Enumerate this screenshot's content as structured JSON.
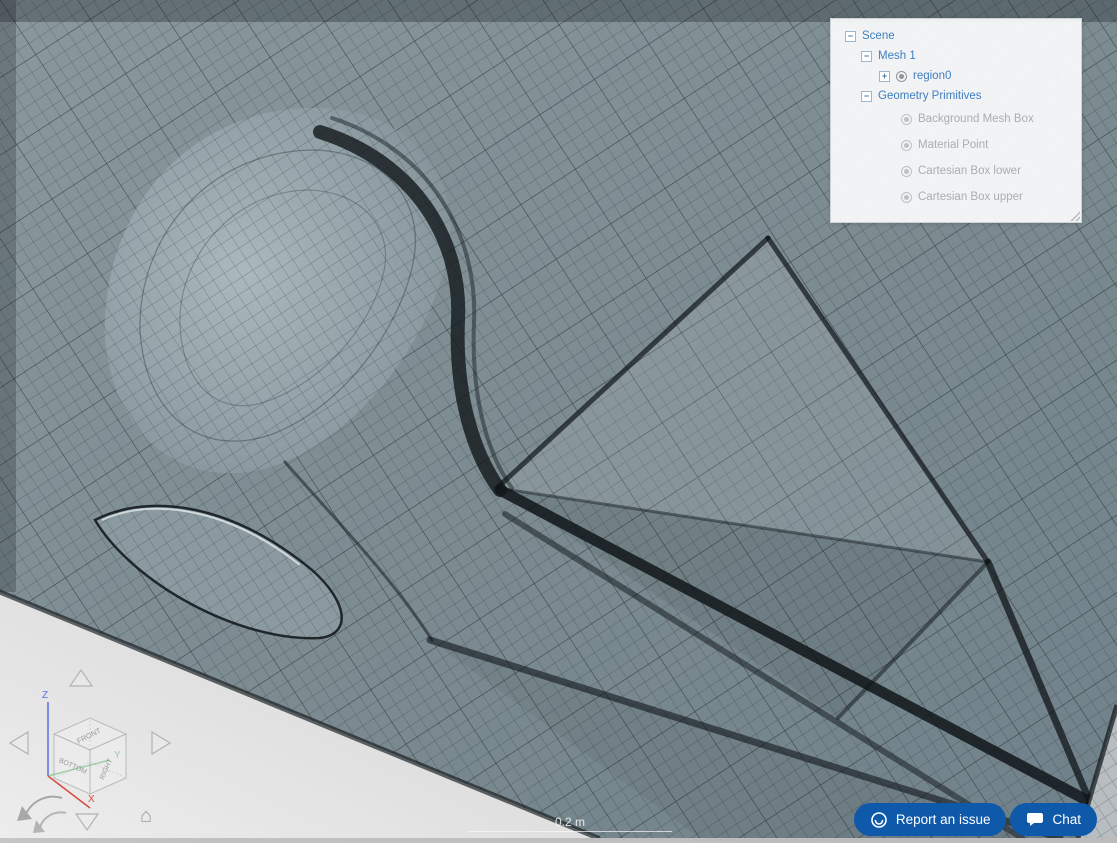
{
  "colors": {
    "tree_active": "#3f7fc1",
    "tree_disabled": "#a9aeb2",
    "button_blue": "#0e59a9",
    "mesh_surface": "#7e8e93",
    "axis_x": "#d84a3f",
    "axis_y": "#58b368",
    "axis_z": "#5b6ee1"
  },
  "scene_tree": {
    "items": [
      {
        "label": "Scene"
      },
      {
        "label": "Mesh 1"
      },
      {
        "label": "region0"
      },
      {
        "label": "Geometry Primitives"
      },
      {
        "label": "Background Mesh Box"
      },
      {
        "label": "Material Point"
      },
      {
        "label": "Cartesian Box lower"
      },
      {
        "label": "Cartesian Box upper"
      }
    ]
  },
  "icons": {
    "collapse": "−",
    "expand": "+",
    "home": "⌂"
  },
  "nav_cube": {
    "face_top": "FRONT",
    "face_left": "BOTTOM",
    "face_right": "RIGHT",
    "axis_x": "X",
    "axis_y": "Y",
    "axis_z": "Z"
  },
  "viewport": {
    "scale_label": "0.2 m"
  },
  "footer": {
    "report_button": "Report an issue",
    "chat_button": "Chat"
  }
}
